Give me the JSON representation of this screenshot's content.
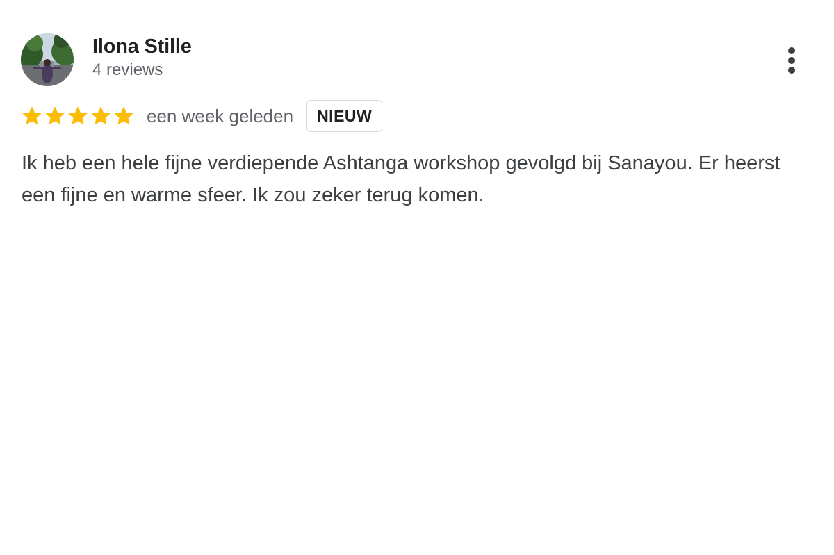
{
  "reviewer": {
    "name": "Ilona Stille",
    "review_count": "4 reviews",
    "avatar_icon": "avatar-photo"
  },
  "review": {
    "rating": 5,
    "rating_max": 5,
    "star_color": "#fbbc04",
    "date": "een week geleden",
    "badge": "NIEUW",
    "text": "Ik heb een hele fijne verdiepende Ashtanga workshop gevolgd bij Sanayou. Er heerst een fijne en warme sfeer. Ik zou zeker terug komen."
  },
  "actions": {
    "more_icon": "more-vert-icon"
  }
}
